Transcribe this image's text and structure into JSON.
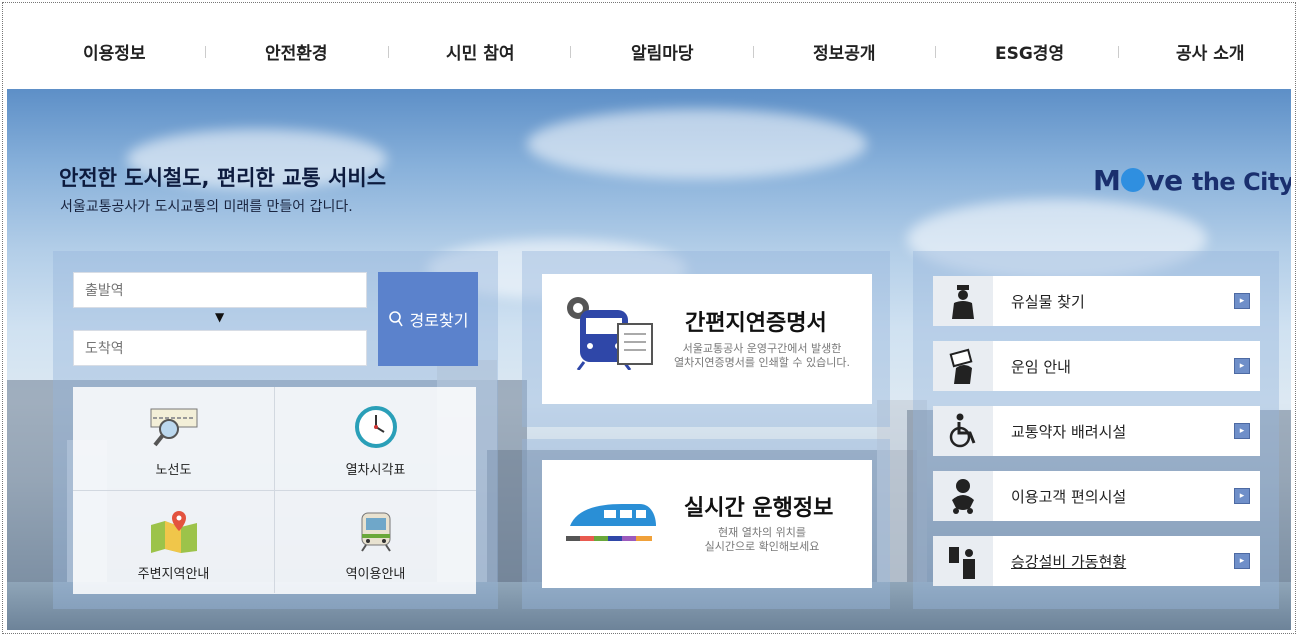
{
  "nav": {
    "items": [
      "이용정보",
      "안전환경",
      "시민 참여",
      "알림마당",
      "정보공개",
      "ESG경영",
      "공사 소개"
    ]
  },
  "hero": {
    "title": "안전한 도시철도, 편리한 교통 서비스",
    "subtitle": "서울교통공사가 도시교통의 미래를 만들어 갑니다.",
    "brand": {
      "part1": "M",
      "part2": "ve ",
      "part3": "the City"
    }
  },
  "route": {
    "departure_placeholder": "출발역",
    "arrival_placeholder": "도착역",
    "search_label": "경로찾기"
  },
  "quick": [
    {
      "label": "노선도",
      "icon": "route-map-icon"
    },
    {
      "label": "열차시각표",
      "icon": "clock-icon"
    },
    {
      "label": "주변지역안내",
      "icon": "map-pin-icon"
    },
    {
      "label": "역이용안내",
      "icon": "train-front-icon"
    }
  ],
  "cards": {
    "delay": {
      "title": "간편지연증명서",
      "desc1": "서울교통공사 운영구간에서 발생한",
      "desc2": "열차지연증명서를 인쇄할 수 있습니다."
    },
    "realtime": {
      "title": "실시간 운행정보",
      "desc1": "현재 열차의 위치를",
      "desc2": "실시간으로 확인해보세요"
    }
  },
  "services": [
    {
      "label": "유실물 찾기",
      "icon": "officer-icon"
    },
    {
      "label": "운임 안내",
      "icon": "ticket-hand-icon"
    },
    {
      "label": "교통약자 배려시설",
      "icon": "wheelchair-icon"
    },
    {
      "label": "이용고객 편의시설",
      "icon": "baby-icon"
    },
    {
      "label": "승강설비 가동현황",
      "icon": "elevator-person-icon"
    }
  ],
  "colors": {
    "accent": "#5b82cc",
    "brand": "#1a2f6e",
    "brand_dot": "#2f8fe0"
  }
}
